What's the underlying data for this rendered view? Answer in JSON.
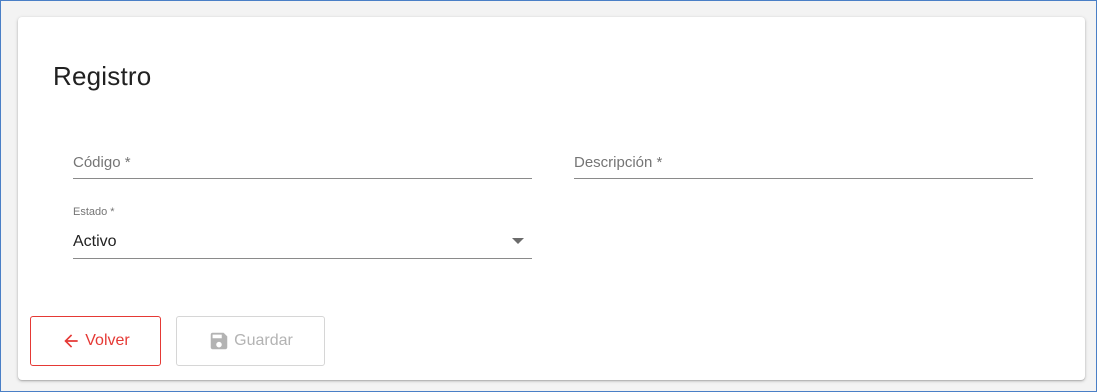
{
  "form": {
    "title": "Registro",
    "fields": {
      "codigo": {
        "placeholder": "Código *",
        "value": ""
      },
      "descripcion": {
        "placeholder": "Descripción *",
        "value": ""
      },
      "estado": {
        "label": "Estado *",
        "value": "Activo"
      }
    }
  },
  "actions": {
    "back": {
      "label": "Volver",
      "icon": "arrow-left-icon",
      "color": "#e53935"
    },
    "save": {
      "label": "Guardar",
      "icon": "floppy-disk-icon",
      "disabled": true,
      "color": "#b3b3b3"
    }
  }
}
